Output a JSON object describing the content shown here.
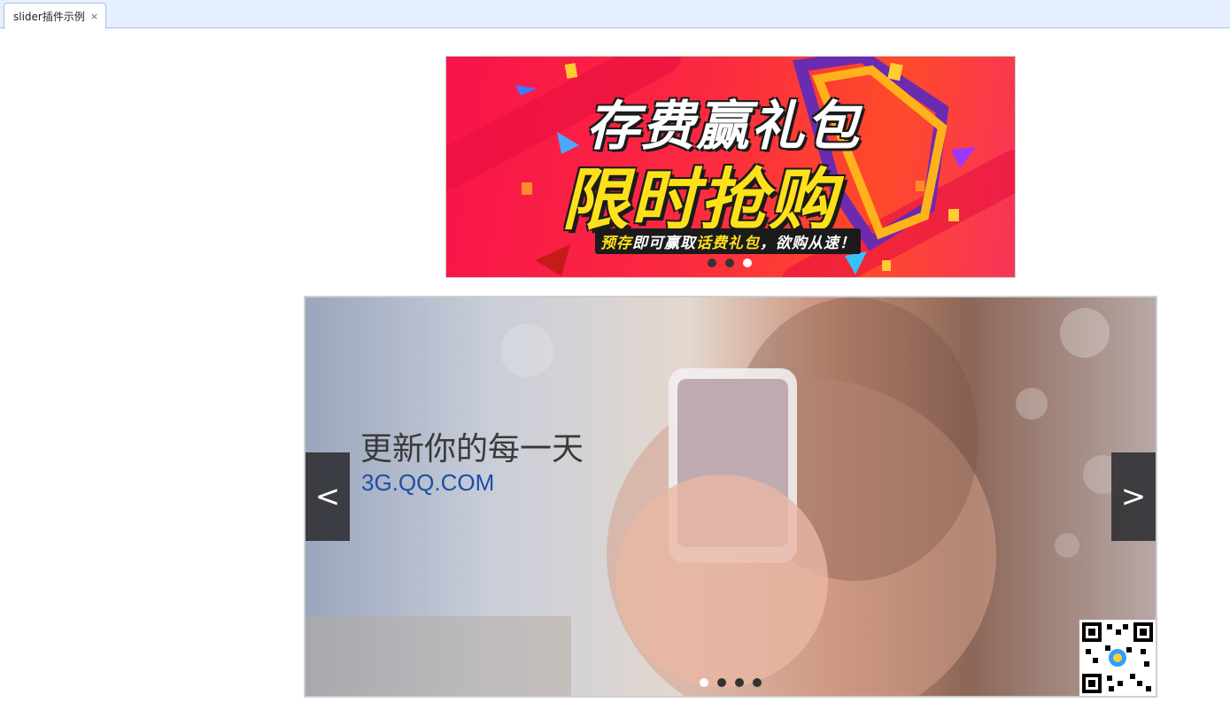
{
  "tab": {
    "label": "slider插件示例",
    "close_glyph": "×"
  },
  "slider1": {
    "headline_top": "存费赢礼包",
    "headline_bottom": "限时抢购",
    "subline_part1": "预存",
    "subline_part2": "即可赢取",
    "subline_part3": "话费礼包",
    "subline_part4": "，欲购从速！",
    "dots": [
      {
        "active": false
      },
      {
        "active": false
      },
      {
        "active": true
      }
    ],
    "colors": {
      "bg": "#f8134a",
      "headline": "#ffffff",
      "highlight": "#ffe11a"
    }
  },
  "slider2": {
    "headline": "更新你的每一天",
    "url": "3G.QQ.COM",
    "prev_glyph": "<",
    "next_glyph": ">",
    "dots": [
      {
        "active": true
      },
      {
        "active": false
      },
      {
        "active": false
      },
      {
        "active": false
      }
    ],
    "qr_code_icon": "qr-code-icon",
    "colors": {
      "url": "#1c4fa6"
    }
  }
}
